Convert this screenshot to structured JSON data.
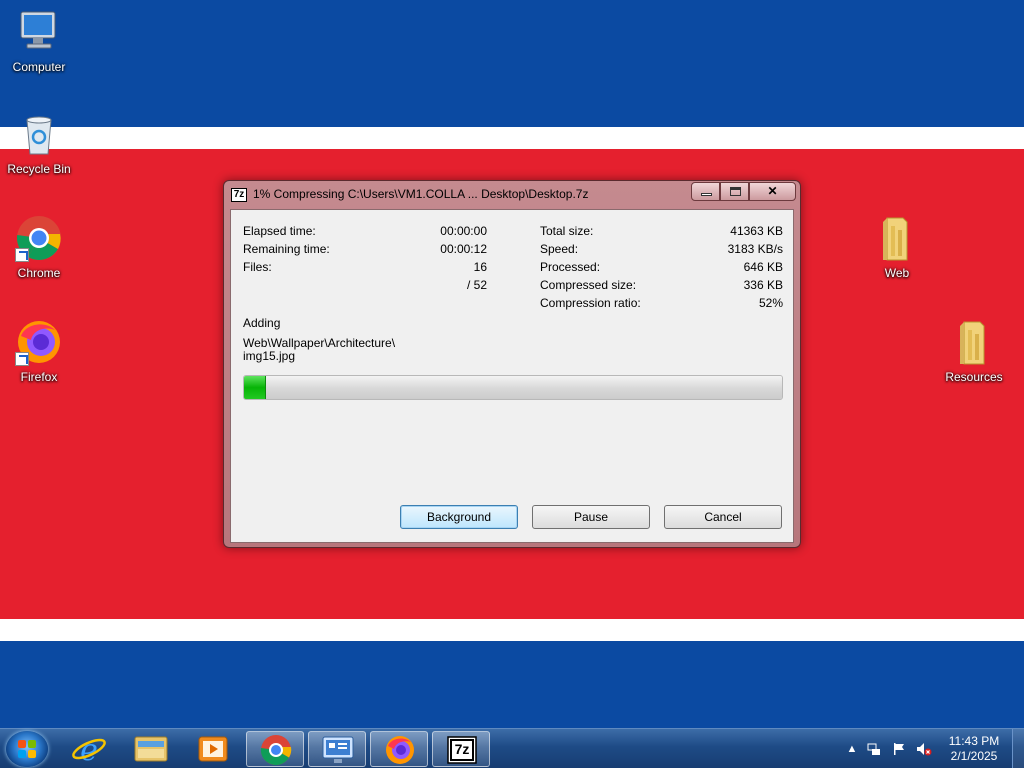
{
  "desktop": {
    "icons": [
      {
        "label": "Computer"
      },
      {
        "label": "Recycle Bin"
      },
      {
        "label": "Chrome"
      },
      {
        "label": "Firefox"
      },
      {
        "label": "Web"
      },
      {
        "label": "Resources"
      }
    ]
  },
  "dialog": {
    "title": "1% Compressing C:\\Users\\VM1.COLLA ... Desktop\\Desktop.7z",
    "app_icon_text": "7z",
    "left": {
      "elapsed_label": "Elapsed time:",
      "elapsed_value": "00:00:00",
      "remaining_label": "Remaining time:",
      "remaining_value": "00:00:12",
      "files_label": "Files:",
      "files_value": "16",
      "files_total": "/ 52"
    },
    "right": {
      "total_size_label": "Total size:",
      "total_size_value": "41363 KB",
      "speed_label": "Speed:",
      "speed_value": "3183 KB/s",
      "processed_label": "Processed:",
      "processed_value": "646 KB",
      "compressed_label": "Compressed size:",
      "compressed_value": "336 KB",
      "ratio_label": "Compression ratio:",
      "ratio_value": "52%"
    },
    "status_label": "Adding",
    "current_file_line1": "Web\\Wallpaper\\Architecture\\",
    "current_file_line2": "img15.jpg",
    "progress_fraction": 0.04,
    "buttons": {
      "background": "Background",
      "pause": "Pause",
      "cancel": "Cancel"
    }
  },
  "taskbar": {
    "items": [
      {
        "icon": "internet-explorer-icon"
      },
      {
        "icon": "file-explorer-icon"
      },
      {
        "icon": "media-player-icon"
      },
      {
        "icon": "chrome-icon"
      },
      {
        "icon": "network-monitor-icon"
      },
      {
        "icon": "firefox-icon"
      },
      {
        "icon": "7zip-icon",
        "text": "7z"
      }
    ],
    "clock_time": "11:43 PM",
    "clock_date": "2/1/2025"
  },
  "colors": {
    "band_blue": "#0b4aa2",
    "band_red": "#e5202e",
    "progress_green": "#07b407"
  }
}
